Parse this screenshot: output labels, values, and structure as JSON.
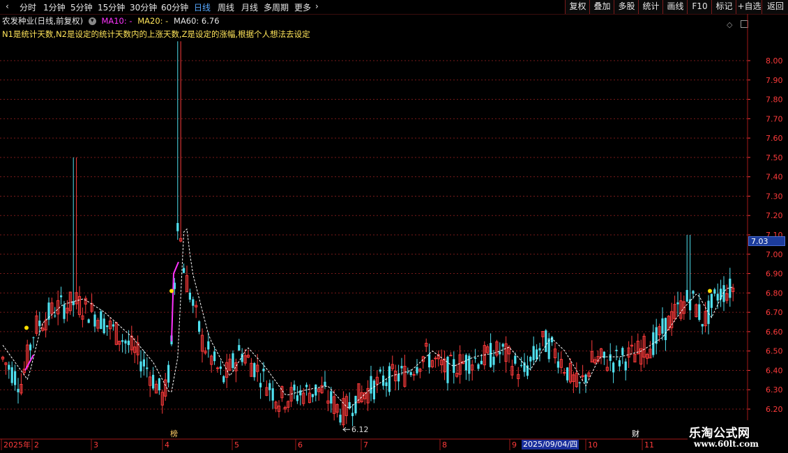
{
  "toolbar": {
    "tabs": [
      "分时",
      "1分钟",
      "5分钟",
      "15分钟",
      "30分钟",
      "60分钟",
      "日线",
      "周线",
      "月线",
      "多周期",
      "更多"
    ],
    "active_tab": "日线",
    "right_buttons": [
      "复权",
      "叠加",
      "多股",
      "统计",
      "画线",
      "F10",
      "标记",
      "+自选",
      "返回"
    ]
  },
  "header": {
    "stock_title": "农发种业(日线,前复权)",
    "ma10": "MA10: -",
    "ma20": "MA20: -",
    "ma60": "MA60: 6.76",
    "note": "N1是统计天数,N2是设定的统计天数内的上涨天数,Z是设定的涨幅,根据个人想法去设定"
  },
  "axis": {
    "price_ticks": [
      "8.00",
      "7.90",
      "7.80",
      "7.70",
      "7.60",
      "7.50",
      "7.40",
      "7.30",
      "7.20",
      "7.10",
      "7.00",
      "6.90",
      "6.80",
      "6.70",
      "6.60",
      "6.50",
      "6.40",
      "6.30",
      "6.20"
    ],
    "current_price": "7.03",
    "x_labels": [
      "2025年",
      "2",
      "3",
      "4",
      "5",
      "6",
      "7",
      "8",
      "9",
      "10",
      "11"
    ],
    "selected_date": "2025/09/04/四",
    "low_marker": "6.12",
    "event_marker_1": "榜",
    "event_marker_2": "财"
  },
  "watermark": {
    "name": "乐淘公式网",
    "url": "www.60lt.com"
  },
  "colors": {
    "up": "#ff3b3b",
    "down": "#4fe0ef",
    "ma_line": "#ffffff",
    "signal": "#ff33ff",
    "grid": "#7a1a1a",
    "note_text": "#ffe55a",
    "active_tab": "#58a8ff"
  }
}
